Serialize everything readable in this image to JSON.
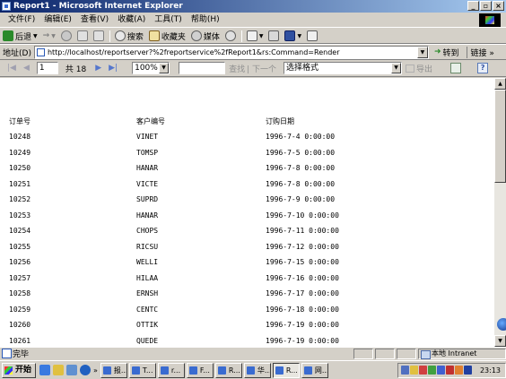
{
  "window": {
    "title": "Report1 - Microsoft Internet Explorer",
    "controls": [
      "_",
      "▫",
      "×"
    ]
  },
  "menu": [
    "文件(F)",
    "编辑(E)",
    "查看(V)",
    "收藏(A)",
    "工具(T)",
    "帮助(H)"
  ],
  "toolbar": {
    "back": "后退",
    "forward_glyph": "→",
    "search": "搜索",
    "favorites": "收藏夹",
    "media": "媒体"
  },
  "address": {
    "label": "地址(D)",
    "url": "http://localhost/reportserver?%2freportservice%2fReport1&rs:Command=Render",
    "go": "转到",
    "links": "链接 »"
  },
  "report_toolbar": {
    "first_glyph": "|◀",
    "prev_glyph": "◀",
    "page": "1",
    "of_text": "共 18",
    "next_glyph": "▶",
    "last_glyph": "▶|",
    "zoom": "100%",
    "find": "查找",
    "find_next": "| 下一个",
    "format_select": "选择格式",
    "export": "导出",
    "help": "?"
  },
  "table": {
    "headers": [
      "订单号",
      "客户编号",
      "订购日期"
    ],
    "rows": [
      [
        "10248",
        "VINET",
        "1996-7-4 0:00:00"
      ],
      [
        "10249",
        "TOMSP",
        "1996-7-5 0:00:00"
      ],
      [
        "10250",
        "HANAR",
        "1996-7-8 0:00:00"
      ],
      [
        "10251",
        "VICTE",
        "1996-7-8 0:00:00"
      ],
      [
        "10252",
        "SUPRD",
        "1996-7-9 0:00:00"
      ],
      [
        "10253",
        "HANAR",
        "1996-7-10 0:00:00"
      ],
      [
        "10254",
        "CHOPS",
        "1996-7-11 0:00:00"
      ],
      [
        "10255",
        "RICSU",
        "1996-7-12 0:00:00"
      ],
      [
        "10256",
        "WELLI",
        "1996-7-15 0:00:00"
      ],
      [
        "10257",
        "HILAA",
        "1996-7-16 0:00:00"
      ],
      [
        "10258",
        "ERNSH",
        "1996-7-17 0:00:00"
      ],
      [
        "10259",
        "CENTC",
        "1996-7-18 0:00:00"
      ],
      [
        "10260",
        "OTTIK",
        "1996-7-19 0:00:00"
      ],
      [
        "10261",
        "QUEDE",
        "1996-7-19 0:00:00"
      ]
    ]
  },
  "status": {
    "done": "完毕",
    "zone": "本地 Intranet"
  },
  "taskbar": {
    "start": "开始",
    "more": "»",
    "buttons": [
      "报...",
      "T...",
      "r...",
      "F...",
      "R...",
      "华...",
      "R...",
      "网..."
    ],
    "clock": "23:13"
  }
}
